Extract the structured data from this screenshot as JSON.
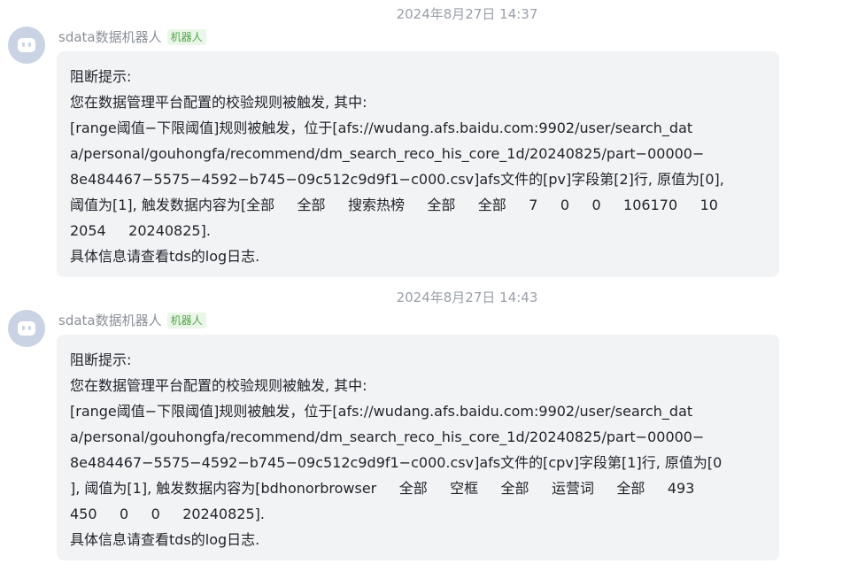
{
  "messages": [
    {
      "timestamp": "2024年8月27日 14:37",
      "sender": "sdata数据机器人",
      "badge": "机器人",
      "lines": [
        "阻断提示:",
        "您在数据管理平台配置的校验规则被触发, 其中:",
        "[range阈值−下限阈值]规则被触发，位于[afs://wudang.afs.baidu.com:9902/user/search_dat",
        "a/personal/gouhongfa/recommend/dm_search_reco_his_core_1d/20240825/part−00000−",
        "8e484467−5575−4592−b745−09c512c9d9f1−c000.csv]afs文件的[pv]字段第[2]行, 原值为[0],",
        "阈值为[1], 触发数据内容为[全部     全部     搜索热榜     全部     全部     7     0     0     106170     10",
        "2054     20240825].",
        "具体信息请查看tds的log日志."
      ]
    },
    {
      "timestamp": "2024年8月27日 14:43",
      "sender": "sdata数据机器人",
      "badge": "机器人",
      "lines": [
        "阻断提示:",
        "您在数据管理平台配置的校验规则被触发, 其中:",
        "[range阈值−下限阈值]规则被触发，位于[afs://wudang.afs.baidu.com:9902/user/search_dat",
        "a/personal/gouhongfa/recommend/dm_search_reco_his_core_1d/20240825/part−00000−",
        "8e484467−5575−4592−b745−09c512c9d9f1−c000.csv]afs文件的[cpv]字段第[1]行, 原值为[0",
        "], 阈值为[1], 触发数据内容为[bdhonorbrowser     全部     空框     全部     运营词     全部     493",
        "450     0     0     20240825].",
        "具体信息请查看tds的log日志."
      ]
    }
  ]
}
